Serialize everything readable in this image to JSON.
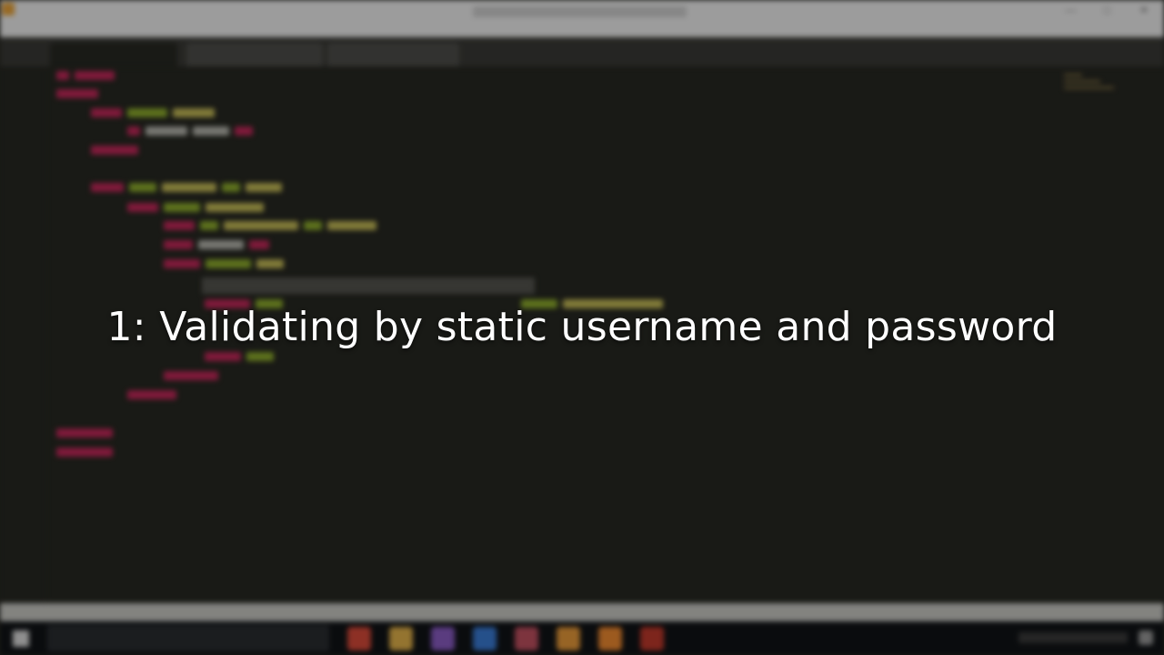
{
  "caption": "1: Validating by static username and password",
  "colors": {
    "editor_bg": "#272822",
    "tag": "#c3285a",
    "attr": "#8fae2d",
    "string": "#c7bd58",
    "caption_text": "#ffffff"
  },
  "window": {
    "controls": [
      "minimize-icon",
      "maximize-icon",
      "close-icon"
    ]
  },
  "taskbar": {
    "icons": [
      "chrome-icon",
      "file-explorer-icon",
      "visual-studio-icon",
      "word-icon",
      "paint-icon",
      "sublime-text-icon",
      "firefox-icon",
      "record-icon"
    ]
  }
}
